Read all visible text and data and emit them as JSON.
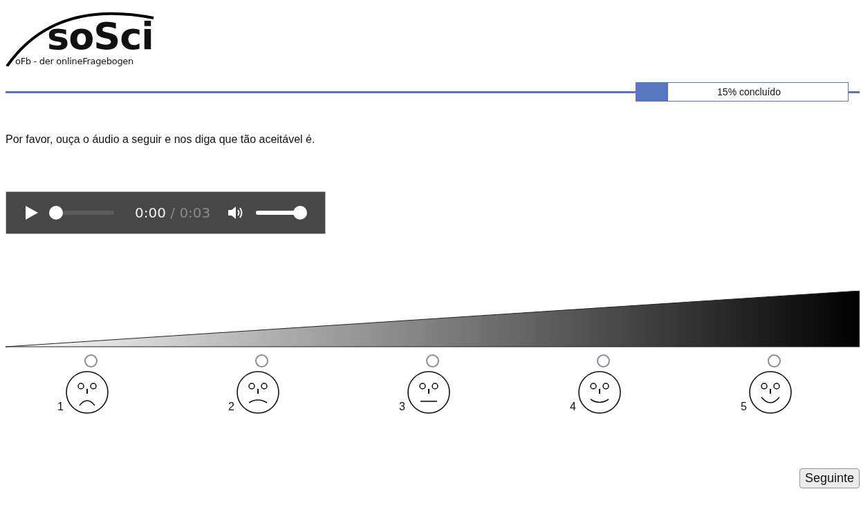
{
  "logo": {
    "title": "soSci",
    "subtitle": "oFb - der onlineFragebogen"
  },
  "progress": {
    "level": 0.15,
    "label": "15% concluído"
  },
  "question": "Por favor, ouça o áudio a seguir e nos diga que tão aceitável é.",
  "audio_player": {
    "current_time": "0:00",
    "separator": "/",
    "duration": "0:03",
    "playing": false,
    "level": 0,
    "volume": {
      "level": 1
    }
  },
  "scale_options": [
    {
      "label": "1",
      "kind": "very-sad",
      "selected": false
    },
    {
      "label": "2",
      "kind": "sad",
      "selected": false
    },
    {
      "label": "3",
      "kind": "neutral",
      "selected": false
    },
    {
      "label": "4",
      "kind": "happy",
      "selected": false
    },
    {
      "label": "5",
      "kind": "very-happy",
      "selected": false
    }
  ],
  "next_button": "Seguinte"
}
